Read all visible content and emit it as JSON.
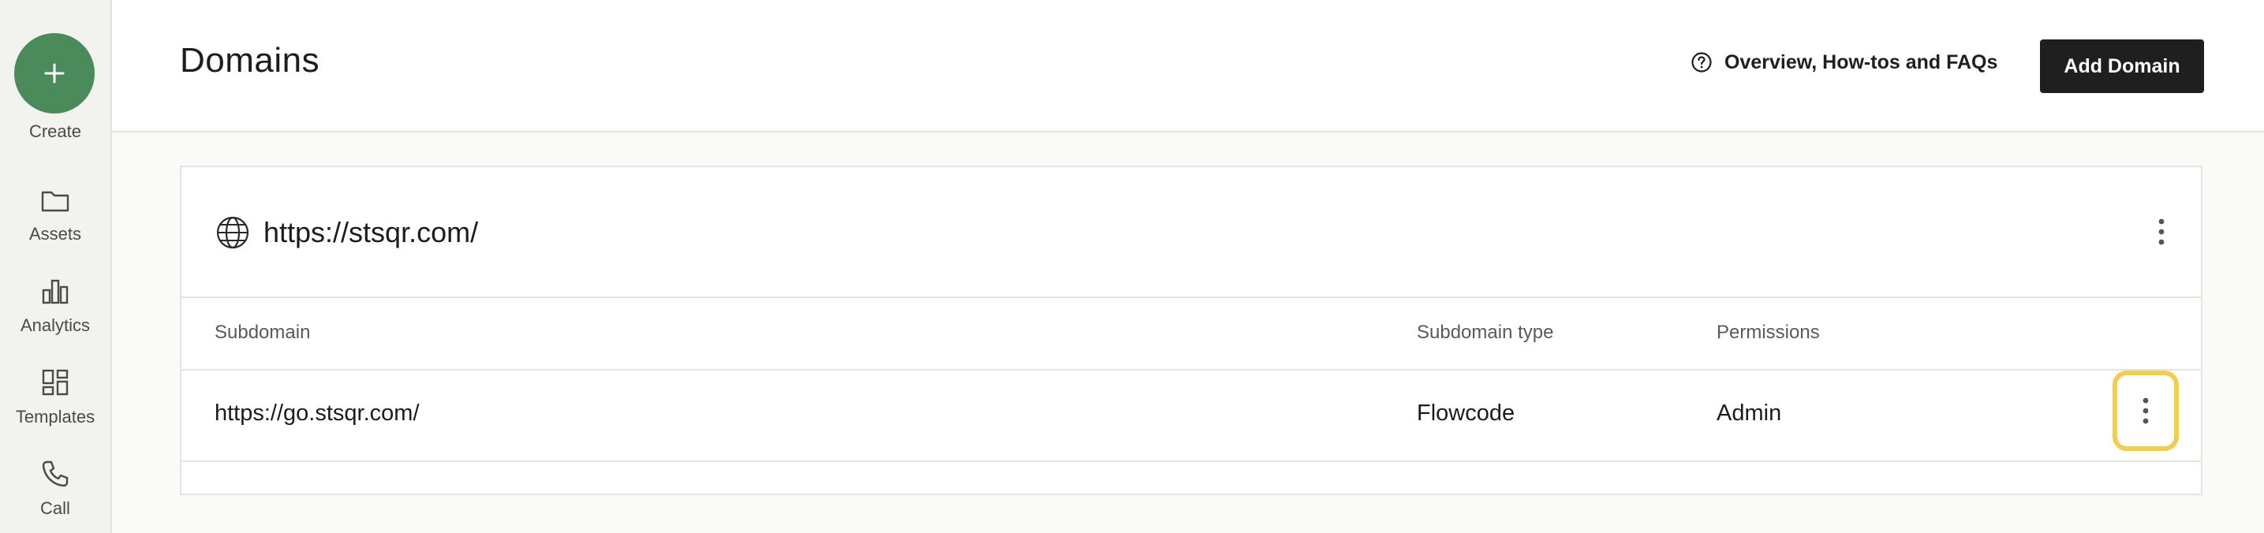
{
  "sidebar": {
    "create_label": "Create",
    "items": [
      {
        "label": "Assets",
        "icon": "folder-icon"
      },
      {
        "label": "Analytics",
        "icon": "bar-chart-icon"
      },
      {
        "label": "Templates",
        "icon": "templates-icon"
      },
      {
        "label": "Call",
        "icon": "phone-icon"
      }
    ]
  },
  "header": {
    "title": "Domains",
    "help_label": "Overview, How-tos and FAQs",
    "add_label": "Add Domain"
  },
  "domain": {
    "url": "https://stsqr.com/"
  },
  "table": {
    "columns": [
      "Subdomain",
      "Subdomain type",
      "Permissions"
    ],
    "rows": [
      {
        "subdomain": "https://go.stsqr.com/",
        "type": "Flowcode",
        "permissions": "Admin"
      }
    ]
  },
  "colors": {
    "accent_green": "#4b8a5b",
    "focus_ring": "#f1cd52",
    "button_dark": "#1f1f1f"
  }
}
